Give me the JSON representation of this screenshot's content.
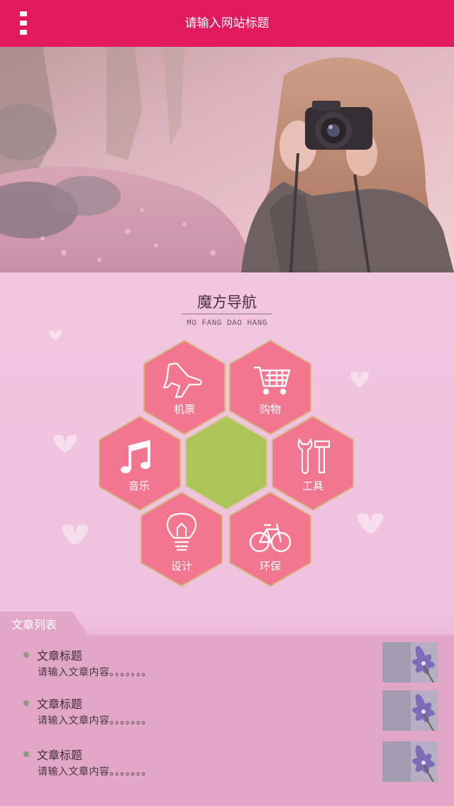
{
  "header": {
    "site_title": "请输入网站标题",
    "menu_icon": "menu-dots-icon",
    "background_color": "#e2195c"
  },
  "banner": {
    "image": "banner-photo-girl-with-camera"
  },
  "nav": {
    "title": "魔方导航",
    "subtitle": "MO FANG DAO HANG",
    "hex_color": "#f27690",
    "center_color": "#adc459",
    "items": [
      {
        "label": "机票",
        "icon": "airplane-icon"
      },
      {
        "label": "购物",
        "icon": "shopping-cart-icon"
      },
      {
        "label": "音乐",
        "icon": "music-note-icon"
      },
      {
        "label": "工具",
        "icon": "tools-icon"
      },
      {
        "label": "设计",
        "icon": "lightbulb-icon"
      },
      {
        "label": "环保",
        "icon": "bicycle-icon"
      }
    ]
  },
  "articles": {
    "tab_label": "文章列表",
    "items": [
      {
        "title": "文章标题",
        "desc": "请输入文章内容。。。。。。。",
        "thumb": "purple-flower-thumbnail"
      },
      {
        "title": "文章标题",
        "desc": "请输入文章内容。。。。。。。",
        "thumb": "purple-flower-thumbnail"
      },
      {
        "title": "文章标题",
        "desc": "请输入文章内容。。。。。。。",
        "thumb": "purple-flower-thumbnail"
      }
    ]
  }
}
